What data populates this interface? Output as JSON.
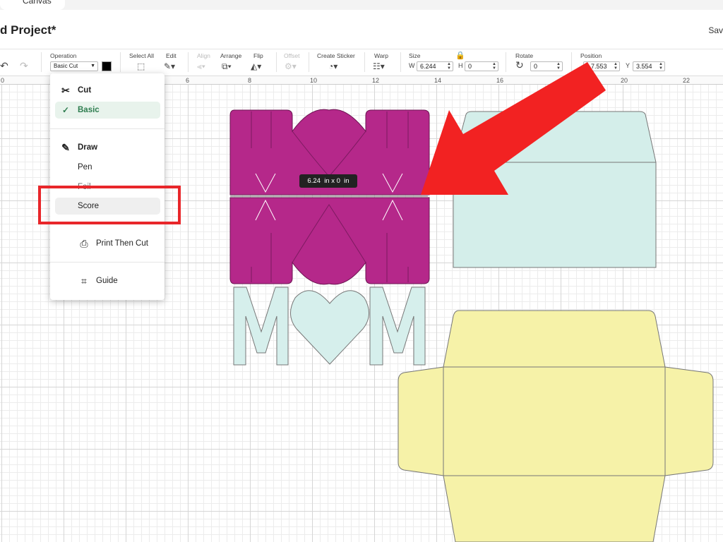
{
  "tab": {
    "label": "Canvas"
  },
  "project": {
    "title": "d Project*",
    "save_label": "Sav"
  },
  "toolbar": {
    "operation": {
      "label": "Operation",
      "value": "Basic Cut"
    },
    "select_all": {
      "label": "Select All"
    },
    "edit": {
      "label": "Edit"
    },
    "align": {
      "label": "Align"
    },
    "arrange": {
      "label": "Arrange"
    },
    "flip": {
      "label": "Flip"
    },
    "offset": {
      "label": "Offset"
    },
    "create_sticker": {
      "label": "Create Sticker"
    },
    "warp": {
      "label": "Warp"
    },
    "size": {
      "label": "Size",
      "w_prefix": "W",
      "w_value": "6.244",
      "h_prefix": "H",
      "h_value": "0"
    },
    "rotate": {
      "label": "Rotate",
      "value": "0"
    },
    "position": {
      "label": "Position",
      "x_value": "7.553",
      "y_prefix": "Y",
      "y_value": "3.554"
    }
  },
  "ruler": {
    "numbers": [
      "0",
      "6",
      "8",
      "10",
      "12",
      "14",
      "16",
      "20",
      "22"
    ]
  },
  "dimension_tooltip": "6.24  in x 0  in",
  "menu": {
    "cut_heading": "Cut",
    "basic": "Basic",
    "draw_heading": "Draw",
    "pen": "Pen",
    "foil": "Foil",
    "score": "Score",
    "print_then_cut": "Print Then Cut",
    "guide": "Guide"
  },
  "colors": {
    "card_magenta": "#b5288a",
    "mom_mint": "#d6efec",
    "envelope_mint": "#d4eeea",
    "envelope_yellow": "#f6f2a8",
    "annotation_red": "#e8262a",
    "selected_green": "#2e7d4f"
  },
  "canvas_number": "3"
}
